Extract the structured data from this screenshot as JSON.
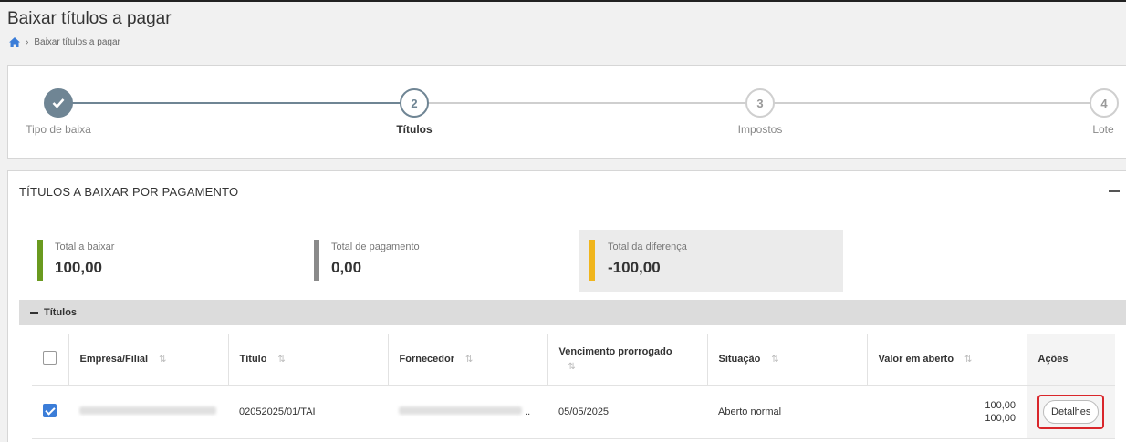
{
  "header": {
    "title": "Baixar títulos a pagar",
    "breadcrumb": {
      "home_icon": "home-icon",
      "current": "Baixar títulos a pagar"
    }
  },
  "stepper": {
    "steps": [
      {
        "number": "",
        "label": "Tipo de baixa",
        "state": "done",
        "icon": "check-icon"
      },
      {
        "number": "2",
        "label": "Títulos",
        "state": "active"
      },
      {
        "number": "3",
        "label": "Impostos",
        "state": "todo"
      },
      {
        "number": "4",
        "label": "Lote",
        "state": "todo"
      }
    ],
    "colors": {
      "done": "#6f8594",
      "todo": "#cfcfcf"
    }
  },
  "section": {
    "title": "TÍTULOS A BAIXAR POR PAGAMENTO",
    "summary": [
      {
        "label": "Total a baixar",
        "value": "100,00",
        "color": "#6a9a1f"
      },
      {
        "label": "Total de pagamento",
        "value": "0,00",
        "color": "#8a8a8a"
      },
      {
        "label": "Total da diferença",
        "value": "-100,00",
        "color": "#f0b51c"
      }
    ]
  },
  "group": {
    "title": "Títulos",
    "columns": [
      "Empresa/Filial",
      "Título",
      "Fornecedor",
      "Vencimento prorrogado",
      "Situação",
      "Valor em aberto",
      "Ações"
    ],
    "rows": [
      {
        "checked": true,
        "empresa_filial": "",
        "titulo": "02052025/01/TAI",
        "fornecedor": "",
        "fornecedor_suffix": "..",
        "vencimento": "05/05/2025",
        "situacao": "Aberto normal",
        "valor_1": "100,00",
        "valor_2": "100,00",
        "acao_label": "Detalhes"
      }
    ]
  }
}
